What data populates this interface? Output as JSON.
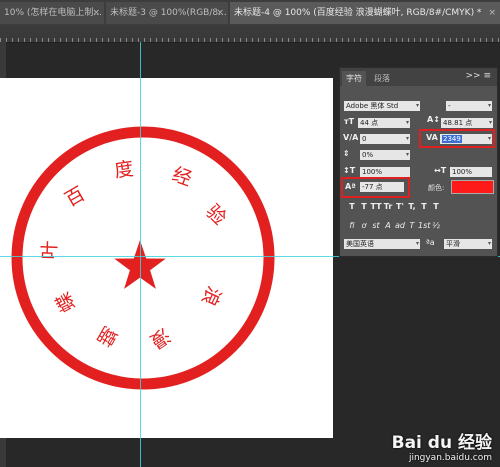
{
  "tabs": [
    {
      "label": "10% (怎样在电脑上制...",
      "close": "×"
    },
    {
      "label": "未标题-3 @ 100%(RGB/8...",
      "close": "×"
    },
    {
      "label": "未标题-4 @ 100% (百度经验 浪漫蝴蝶叶, RGB/8#/CMYK) *",
      "close": "×"
    }
  ],
  "stamp": {
    "ring_color": "#e32020",
    "chars": [
      "百",
      "度",
      "经",
      "验",
      "浪",
      "漫",
      "蝴",
      "蝶",
      "叶"
    ],
    "star_icon": "star-icon"
  },
  "panel": {
    "tab_character": "字符",
    "tab_paragraph": "段落",
    "menu": ">> ≡",
    "font_family": "Adobe 黑体 Std",
    "font_style": "-",
    "font_size": "44 点",
    "leading": "48.81 点",
    "kerning": "0",
    "tracking": "2349",
    "scale_v": "0%",
    "scale_v2": "100%",
    "scale_h": "100%",
    "baseline": "-77 点",
    "color_label": "颜色:",
    "color_value": "#ff1a1a",
    "style_buttons": [
      "T",
      "T",
      "TT",
      "Tr",
      "T'",
      "T,",
      "T",
      "T"
    ],
    "ot_buttons": [
      "fi",
      "ơ",
      "st",
      "A",
      "ad",
      "T",
      "1st",
      "½"
    ],
    "language": "美国英语",
    "aa_label": "ªa",
    "antialias": "平滑"
  },
  "watermark": {
    "logo": "Bai du 经验",
    "url": "jingyan.baidu.com"
  }
}
